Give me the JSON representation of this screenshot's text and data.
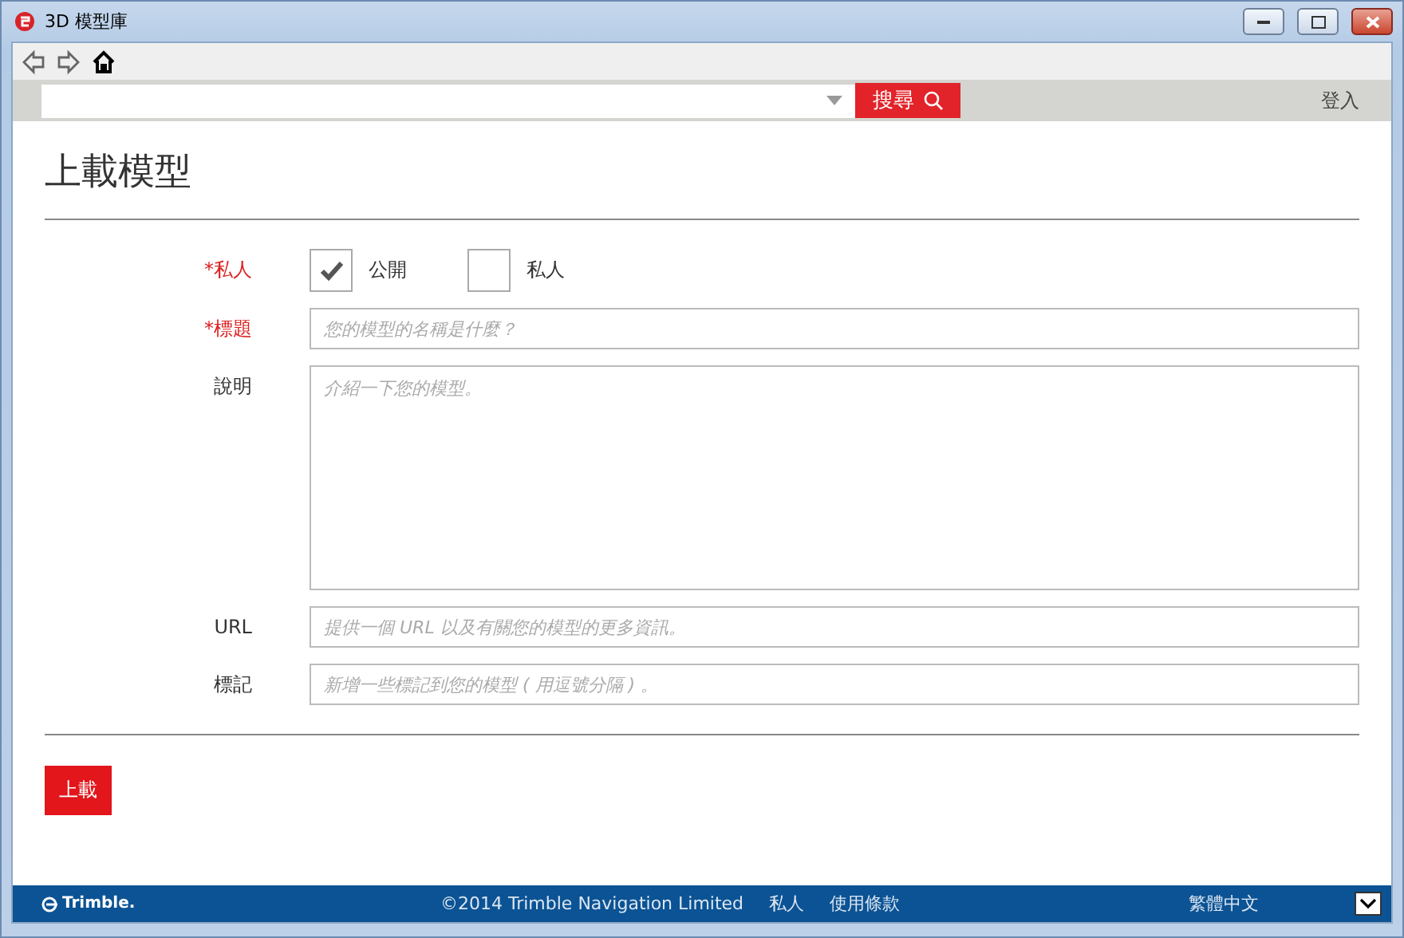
{
  "window": {
    "title": "3D 模型庫"
  },
  "search": {
    "button": "搜尋"
  },
  "login": "登入",
  "page_title": "上載模型",
  "fields": [
    {
      "kind": "choice",
      "label": "*私人",
      "required": true,
      "options": [
        {
          "label": "公開",
          "checked": true
        },
        {
          "label": "私人",
          "checked": false
        }
      ]
    },
    {
      "kind": "text",
      "label": "*標題",
      "required": true,
      "placeholder": "您的模型的名稱是什麼？"
    },
    {
      "kind": "textarea",
      "label": "說明",
      "required": false,
      "placeholder": "介紹一下您的模型。"
    },
    {
      "kind": "text",
      "label": "URL",
      "required": false,
      "placeholder": "提供一個 URL 以及有關您的模型的更多資訊。"
    },
    {
      "kind": "text",
      "label": "標記",
      "required": false,
      "placeholder": "新增一些標記到您的模型 ( 用逗號分隔 ) 。"
    }
  ],
  "submit": "上載",
  "footer": {
    "logo": "Trimble.",
    "copyright": "©2014 Trimble Navigation Limited",
    "links": [
      "私人",
      "使用條款"
    ],
    "language": "繁體中文"
  }
}
